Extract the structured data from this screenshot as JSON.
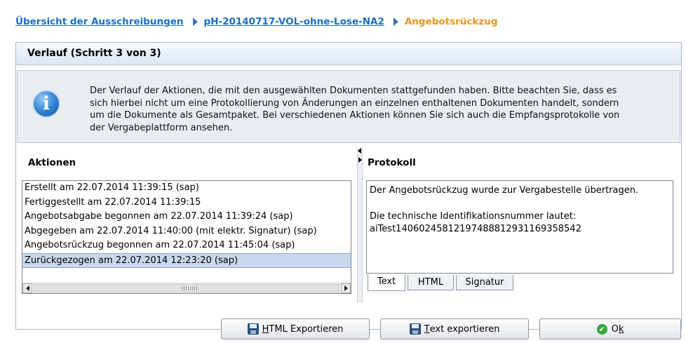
{
  "breadcrumb": {
    "items": [
      {
        "label": "Übersicht der Ausschreibungen"
      },
      {
        "label": "pH-20140717-VOL-ohne-Lose-NA2"
      },
      {
        "label": "Angebotsrückzug"
      }
    ]
  },
  "panel": {
    "title": "Verlauf (Schritt 3 von 3)"
  },
  "info": {
    "lines": [
      "Der Verlauf der Aktionen, die mit den ausgewählten Dokumenten stattgefunden haben. Bitte beachten Sie, dass es",
      "sich hierbei nicht um eine Protokollierung von Änderungen an einzelnen enthaltenen Dokumenten handelt, sondern",
      "um die Dokumente als Gesamtpaket. Bei verschiedenen Aktionen können Sie sich auch die Empfangsprotokolle von",
      "der Vergabeplattform ansehen."
    ]
  },
  "actions": {
    "title": "Aktionen",
    "items": [
      "Erstellt am 22.07.2014 11:39:15 (sap)",
      "Fertiggestellt am 22.07.2014 11:39:15",
      "Angebotsabgabe begonnen am 22.07.2014 11:39:24 (sap)",
      "Abgegeben am 22.07.2014 11:40:00 (mit elektr. Signatur) (sap)",
      "Angebotsrückzug begonnen am 22.07.2014 11:45:04 (sap)",
      "Zurückgezogen am 22.07.2014 12:23:20 (sap)"
    ],
    "selected_index": 5
  },
  "protocol": {
    "title": "Protokoll",
    "line1": "Der Angebotsrückzug wurde zur Vergabestelle übertragen.",
    "line2": "Die technische Identifikationsnummer lautet:",
    "line3": "aiTest1406024581219748881293116935854​2"
  },
  "tabs": [
    "Text",
    "HTML",
    "Signatur"
  ],
  "buttons": {
    "html_export_prefix": "H",
    "html_export_rest": "TML Exportieren",
    "text_export_prefix": "T",
    "text_export_rest": "ext exportieren",
    "ok_prefix": "O",
    "ok_rest": "k"
  },
  "colors": {
    "link": "#1a6ec9",
    "current": "#f0961e",
    "selected_row": "#c8d8ee"
  }
}
